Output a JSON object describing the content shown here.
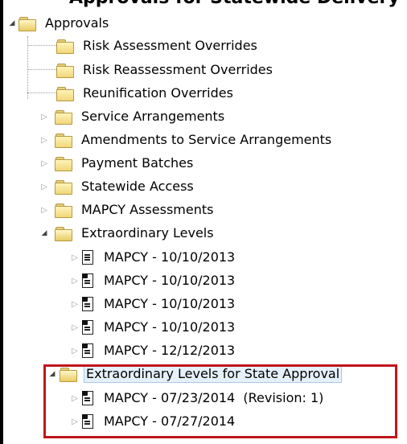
{
  "top_text": "Approvals for Statewide Delivery",
  "tree": {
    "root": {
      "label": "Approvals"
    },
    "children": [
      {
        "label": "Risk Assessment Overrides"
      },
      {
        "label": "Risk Reassessment Overrides"
      },
      {
        "label": "Reunification Overrides"
      },
      {
        "label": "Service Arrangements"
      },
      {
        "label": "Amendments to Service Arrangements"
      },
      {
        "label": "Payment Batches"
      },
      {
        "label": "Statewide Access"
      },
      {
        "label": "MAPCY Assessments"
      },
      {
        "label": "Extraordinary Levels"
      }
    ],
    "extraordinary_items": [
      {
        "label": "MAPCY - 10/10/2013"
      },
      {
        "label": "MAPCY - 10/10/2013"
      },
      {
        "label": "MAPCY - 10/10/2013"
      },
      {
        "label": "MAPCY - 10/10/2013"
      },
      {
        "label": "MAPCY - 12/12/2013"
      }
    ],
    "state_approval": {
      "label": "Extraordinary Levels for State Approval"
    },
    "state_items": [
      {
        "label": "MAPCY - 07/23/2014  (Revision: 1)"
      },
      {
        "label": "MAPCY - 07/27/2014"
      }
    ]
  },
  "colors": {
    "highlight_border": "#c0141c",
    "selection_bg": "#e6f0fa",
    "folder": "#f2d77a"
  }
}
